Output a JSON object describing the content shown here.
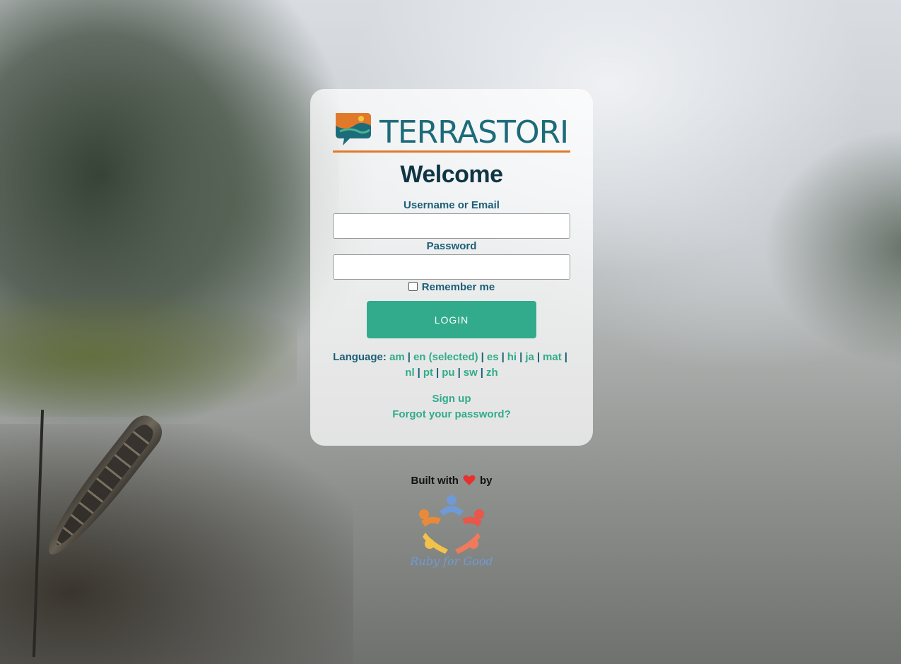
{
  "brand": {
    "logo_text": "TERRASTORIES",
    "logo_colors": {
      "teal": "#1c6b7a",
      "orange": "#e07a2a",
      "green": "#4bb38f"
    }
  },
  "login": {
    "heading": "Welcome",
    "username_label": "Username or Email",
    "username_value": "",
    "password_label": "Password",
    "password_value": "",
    "remember_label": "Remember me",
    "remember_checked": false,
    "submit_label": "LOGIN"
  },
  "language": {
    "label": "Language:",
    "options": [
      {
        "code": "am"
      },
      {
        "code": "en (selected)"
      },
      {
        "code": "es"
      },
      {
        "code": "hi"
      },
      {
        "code": "ja"
      },
      {
        "code": "mat"
      },
      {
        "code": "nl"
      },
      {
        "code": "pt"
      },
      {
        "code": "pu"
      },
      {
        "code": "sw"
      },
      {
        "code": "zh"
      }
    ],
    "separator": "|"
  },
  "links": {
    "signup": "Sign up",
    "forgot": "Forgot your password?"
  },
  "footer": {
    "built_with": "Built with",
    "by": "by",
    "icon": "heart-icon",
    "partner_logo_text": "Ruby for Good"
  },
  "colors": {
    "accent": "#31ab8b",
    "label": "#1c5f78",
    "heading": "#0f3544",
    "heart": "#e8302f"
  }
}
